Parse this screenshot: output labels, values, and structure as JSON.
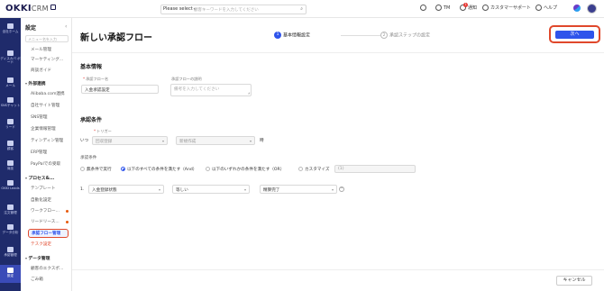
{
  "app": {
    "logo_main": "OKKI",
    "logo_sub": "CRM"
  },
  "topbar": {
    "search_scope": "Please select",
    "search_placeholder": "顧客キーワードを入力してください",
    "tm_label": "TM",
    "notify_label": "通知",
    "notify_count": "1",
    "support_label": "カスタマーサポート",
    "help_label": "ヘルプ"
  },
  "rail": {
    "items": [
      {
        "label": "全社ホーム"
      },
      {
        "label": "ディスカバ ボード"
      },
      {
        "label": "メール"
      },
      {
        "label": "SNSチャット"
      },
      {
        "label": "リード"
      },
      {
        "label": "顧客"
      },
      {
        "label": "商談"
      },
      {
        "label": "OKKI Leads"
      },
      {
        "label": "注文管理"
      },
      {
        "label": "データ分析"
      },
      {
        "label": "承認管理"
      },
      {
        "label": "設定"
      }
    ]
  },
  "sidebar": {
    "title": "設定",
    "search_placeholder": "メニュー名を入力",
    "items_top": [
      "メール管理",
      "マーケティング...",
      "商談ガイド"
    ],
    "group_external": "外部連携",
    "items_external": [
      "Alibaba.com連携",
      "自社サイト管理",
      "SNS管理",
      "企業情報管理",
      "ティンディン管理",
      "ERP管理",
      "PayPalでの受取"
    ],
    "group_process": "プロセス&...",
    "items_process": [
      "テンプレート",
      "自動化設定",
      "ワークフロー...",
      "リードリース...",
      "承認フロー管理",
      "テスク設定"
    ],
    "group_data": "データ管理",
    "items_data": [
      "顧客のエクスポ...",
      "ごみ箱"
    ]
  },
  "main": {
    "title": "新しい承認フロー",
    "step1_num": "1",
    "step1_label": "基本情報設定",
    "step2_num": "2",
    "step2_label": "承認ステップの設定",
    "next_label": "次へ",
    "basic_info_title": "基本情報",
    "flow_name_label": "承認フロー名",
    "flow_name_value": "入金承認設定",
    "flow_desc_label": "承認フローの説明",
    "flow_desc_placeholder": "備考を入力してください",
    "conditions_title": "承認条件",
    "trigger_label": "トリガー",
    "when_label": "いつ",
    "trigger_object": "回収登録",
    "trigger_event": "新規作成",
    "when_suffix": "時",
    "cond_label": "承認条件",
    "radio_unconditional": "無条件で実行",
    "radio_all": "以下のすべての条件を満たす（And）",
    "radio_any": "以下のいずれかの条件を満たす（OR）",
    "radio_custom": "カスタマイズ",
    "custom_placeholder": "(1)",
    "cond_row_index": "1.",
    "cond_field": "入金登録状態",
    "cond_operator": "等しい",
    "cond_value": "精算完了",
    "cancel_label": "キャンセル"
  }
}
